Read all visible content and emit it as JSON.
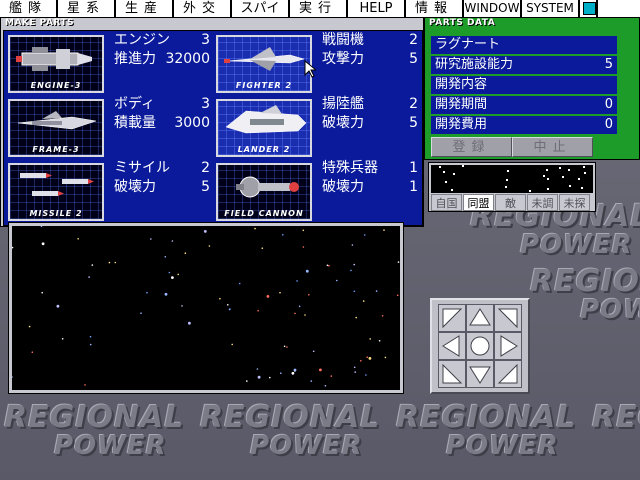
{
  "menu": {
    "items": [
      "艦隊",
      "星系",
      "生産",
      "外交",
      "スパイ",
      "実行",
      "HELP",
      "情報",
      "WINDOW",
      "SYSTEM"
    ]
  },
  "background_logo": {
    "line1": "REGIONAL",
    "line2": "POWER"
  },
  "make_parts": {
    "title": "MAKE PARTS",
    "parts": [
      {
        "caption": "ENGINE-3",
        "name": "エンジン",
        "level": "3",
        "stat_label": "推進力",
        "stat_value": "32000"
      },
      {
        "caption": "FIGHTER 2",
        "name": "戦闘機",
        "level": "2",
        "stat_label": "攻撃力",
        "stat_value": "5"
      },
      {
        "caption": "FRAME-3",
        "name": "ボディ",
        "level": "3",
        "stat_label": "積載量",
        "stat_value": "3000"
      },
      {
        "caption": "LANDER  2",
        "name": "揚陸艦",
        "level": "2",
        "stat_label": "破壊力",
        "stat_value": "5"
      },
      {
        "caption": "MISSILE 2",
        "name": "ミサイル",
        "level": "2",
        "stat_label": "破壊力",
        "stat_value": "5"
      },
      {
        "caption": "FIELD CANNON",
        "name": "特殊兵器",
        "level": "1",
        "stat_label": "破壊力",
        "stat_value": "1"
      }
    ]
  },
  "parts_data": {
    "title": "PARTS DATA",
    "name": "ラグナート",
    "facility_label": "研究施設能力",
    "facility_value": "5",
    "content_label": "開発内容",
    "period_label": "開発期間",
    "period_value": "0",
    "cost_label": "開発費用",
    "cost_value": "0",
    "register_button": "登録",
    "cancel_button": "中止"
  },
  "mini_map": {
    "tabs": [
      "自国",
      "同盟",
      "敵",
      "未調",
      "未探"
    ],
    "active_tab": "同盟"
  },
  "colors": {
    "panel_blue": "#0a1a9a",
    "data_green": "#1e9c2a",
    "window_gray": "#c8c8d0"
  }
}
